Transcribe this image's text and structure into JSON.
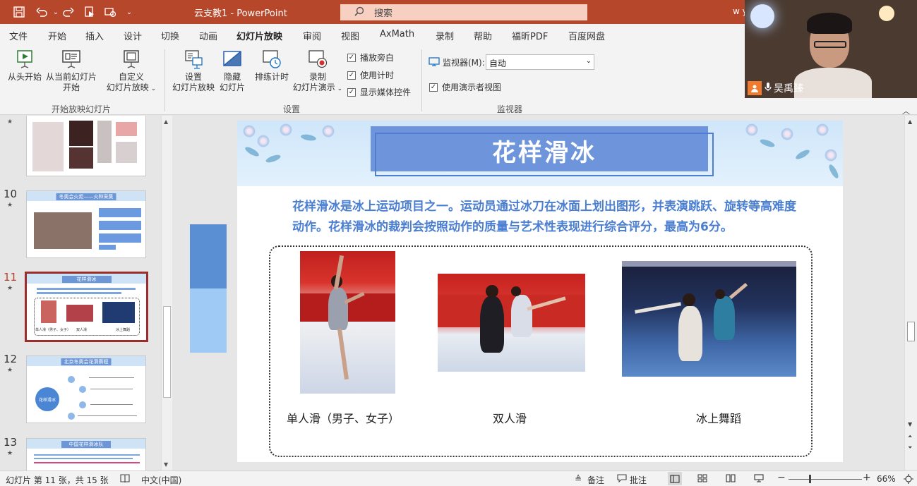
{
  "titlebar": {
    "title": "云支教1  -  PowerPoint",
    "search_placeholder": "搜索",
    "user_initials": "w y",
    "quick_access": [
      "save-icon",
      "undo-icon",
      "redo-icon",
      "from-beginning-icon",
      "customize-icon",
      "dropdown-icon"
    ]
  },
  "tabs": [
    "文件",
    "开始",
    "插入",
    "设计",
    "切换",
    "动画",
    "幻灯片放映",
    "审阅",
    "视图",
    "AxMath",
    "录制",
    "帮助",
    "福昕PDF",
    "百度网盘"
  ],
  "active_tab": "幻灯片放映",
  "ribbon": {
    "from_beginning": "从头开始",
    "from_current_line1": "从当前幻灯片",
    "from_current_line2": "开始",
    "custom_line1": "自定义",
    "custom_line2": "幻灯片放映",
    "group_start": "开始放映幻灯片",
    "setup_line1": "设置",
    "setup_line2": "幻灯片放映",
    "hide_line1": "隐藏",
    "hide_line2": "幻灯片",
    "rehearse": "排练计时",
    "record_line1": "录制",
    "record_line2": "幻灯片演示",
    "play_narration": "播放旁白",
    "use_timings": "使用计时",
    "show_media_controls": "显示媒体控件",
    "group_setup": "设置",
    "monitor_label": "监视器(M):",
    "monitor_value": "自动",
    "presenter_view": "使用演示者视图",
    "group_monitor": "监视器"
  },
  "video": {
    "participant_name": "吴禹臻"
  },
  "thumbnails": {
    "items": [
      {
        "number": "",
        "title": ""
      },
      {
        "number": "10",
        "title": "冬奥会火炬——火种采集"
      },
      {
        "number": "11",
        "title": "花样滑冰",
        "captions": [
          "单人滑（男子、女子）",
          "双人滑",
          "冰上舞蹈"
        ]
      },
      {
        "number": "12",
        "title": "北京冬奥会花滑赛程",
        "center_label": "花样滑冰"
      },
      {
        "number": "13",
        "title": "中国花样滑冰队"
      }
    ],
    "active_number": "11"
  },
  "slide": {
    "title": "花样滑冰",
    "description": "花样滑冰是冰上运动项目之一。运动员通过冰刀在冰面上划出图形，并表演跳跃、旋转等高难度动作。花样滑冰的裁判会按照动作的质量与艺术性表现进行综合评分，最高为6分。",
    "captions": [
      "单人滑（男子、女子）",
      "双人滑",
      "冰上舞蹈"
    ]
  },
  "status": {
    "slide_info": "幻灯片 第 11 张，共 15 张",
    "language": "中文(中国)",
    "notes": "备注",
    "comments": "批注",
    "zoom_minus": "−",
    "zoom_plus": "+",
    "zoom_level": "66%"
  },
  "colors": {
    "accent": "#b7472a",
    "slide_blue": "#4a7ed1",
    "title_box": "#6e95db"
  }
}
